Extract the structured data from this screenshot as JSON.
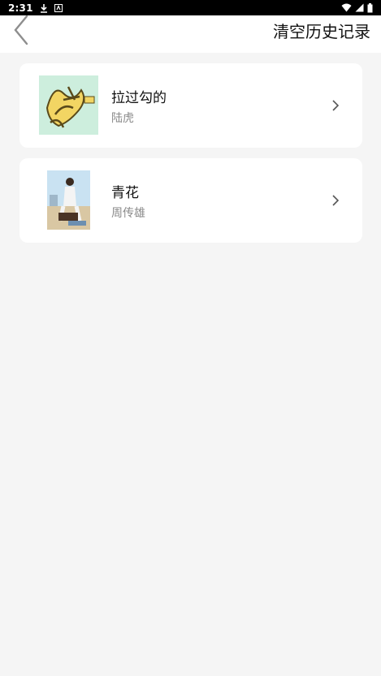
{
  "status_bar": {
    "time": "2:31",
    "icons": [
      "download-icon",
      "notification-icon",
      "wifi-icon",
      "signal-icon",
      "battery-icon"
    ]
  },
  "header": {
    "back_icon": "chevron-left-icon",
    "clear_label": "清空历史记录"
  },
  "history": [
    {
      "title": "拉过勾的",
      "author": "陆虎",
      "cover_icon": "album-cover"
    },
    {
      "title": "青花",
      "author": "周传雄",
      "cover_icon": "album-cover"
    }
  ],
  "colors": {
    "background": "#f5f5f5",
    "card": "#ffffff",
    "secondary_text": "#8a8a8a"
  }
}
